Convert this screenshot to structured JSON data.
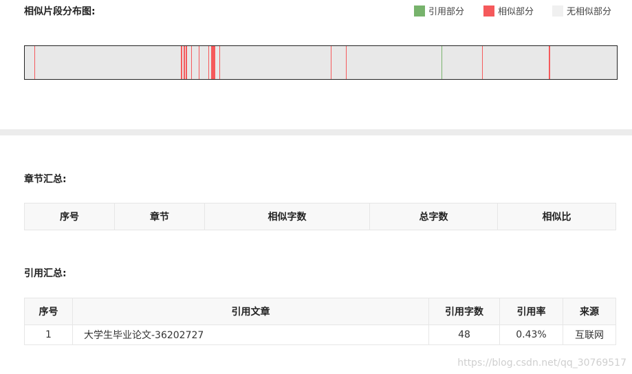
{
  "distribution": {
    "title": "相似片段分布图:",
    "legend": [
      {
        "label": "引用部分",
        "color": "#77b36c"
      },
      {
        "label": "相似部分",
        "color": "#f5595b"
      },
      {
        "label": "无相似部分",
        "color": "#f0f0f0"
      }
    ]
  },
  "chapter_summary": {
    "title": "章节汇总:",
    "headers": [
      "序号",
      "章节",
      "相似字数",
      "总字数",
      "相似比"
    ]
  },
  "citation_summary": {
    "title": "引用汇总:",
    "headers": [
      "序号",
      "引用文章",
      "引用字数",
      "引用率",
      "来源"
    ],
    "rows": [
      {
        "index": "1",
        "article": "大学生毕业论文-36202727",
        "chars": "48",
        "rate": "0.43%",
        "source": "互联网"
      }
    ]
  },
  "watermark": "https://blog.csdn.net/qq_30769517"
}
